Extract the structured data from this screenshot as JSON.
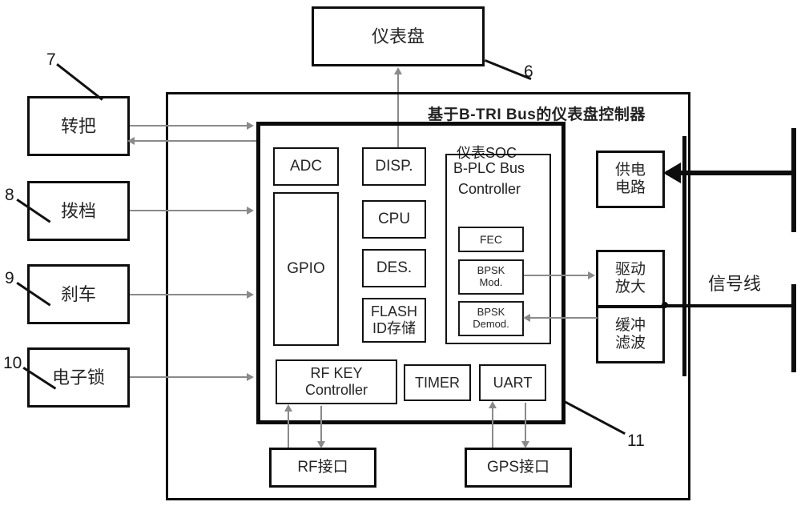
{
  "diagram": {
    "title": "基于B-TRI Bus的仪表盘控制器",
    "dashboard": {
      "label": "仪表盘",
      "ref": "6"
    },
    "inputs": [
      {
        "label": "转把",
        "ref": "7"
      },
      {
        "label": "拨档",
        "ref": "8"
      },
      {
        "label": "刹车",
        "ref": "9"
      },
      {
        "label": "电子锁",
        "ref": "10"
      }
    ],
    "soc": {
      "label": "仪表SOC",
      "ref": "11",
      "blocks": {
        "adc": "ADC",
        "gpio": "GPIO",
        "disp": "DISP.",
        "cpu": "CPU",
        "des": "DES.",
        "flash_line1": "FLASH",
        "flash_line2": "ID存储",
        "rfkey_line1": "RF KEY",
        "rfkey_line2": "Controller",
        "timer": "TIMER",
        "uart": "UART"
      },
      "bus_controller": {
        "line1": "B-PLC Bus",
        "line2": "Controller",
        "fec": "FEC",
        "bpsk_mod_line1": "BPSK",
        "bpsk_mod_line2": "Mod.",
        "bpsk_demod_line1": "BPSK",
        "bpsk_demod_line2": "Demod."
      }
    },
    "interfaces": [
      {
        "label": "RF接口"
      },
      {
        "label": "GPS接口"
      }
    ],
    "right_blocks": {
      "power_line1": "供电",
      "power_line2": "电路",
      "drive_line1": "驱动",
      "drive_line2": "放大",
      "buffer_line1": "缓冲",
      "buffer_line2": "滤波"
    },
    "signal_line_label": "信号线"
  }
}
